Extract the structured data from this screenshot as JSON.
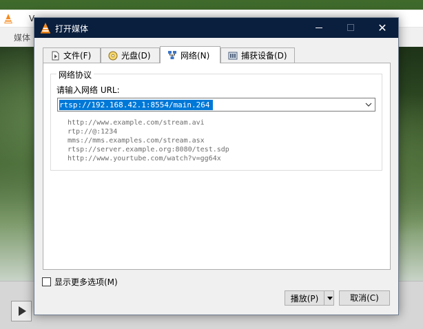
{
  "background_window": {
    "title": "V",
    "menu_item": "媒体"
  },
  "dialog": {
    "title": "打开媒体",
    "minimize_label": "",
    "close_label": "✕"
  },
  "tabs": [
    {
      "label": "文件(F)",
      "icon": "file-icon"
    },
    {
      "label": "光盘(D)",
      "icon": "disc-icon"
    },
    {
      "label": "网络(N)",
      "icon": "network-icon",
      "active": true
    },
    {
      "label": "捕获设备(D)",
      "icon": "capture-device-icon"
    }
  ],
  "network": {
    "group_title": "网络协议",
    "url_label": "请输入网络 URL:",
    "url_value": "rtsp://192.168.42.1:8554/main.264",
    "examples": [
      "http://www.example.com/stream.avi",
      "rtp://@:1234",
      "mms://mms.examples.com/stream.asx",
      "rtsp://server.example.org:8080/test.sdp",
      "http://www.yourtube.com/watch?v=gg64x"
    ]
  },
  "options": {
    "more_options_label": "显示更多选项(M)",
    "more_options_checked": false
  },
  "buttons": {
    "play_label": "播放(P)",
    "cancel_label": "取消(C)"
  },
  "colors": {
    "title_bar": "#0a1e3d",
    "selection": "#0078d7",
    "vlc_orange": "#f68a1e"
  }
}
